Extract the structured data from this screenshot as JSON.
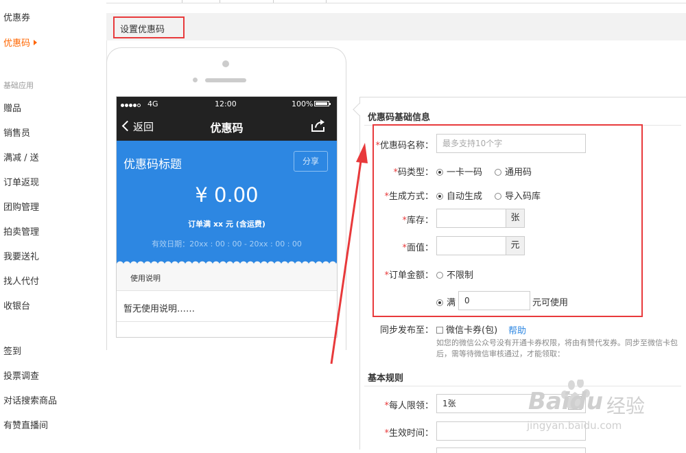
{
  "sidebar": {
    "items_top": [
      {
        "label": "优惠券",
        "active": false
      },
      {
        "label": "优惠码",
        "active": true
      }
    ],
    "category": "基础应用",
    "items_basic": [
      "赠品",
      "销售员",
      "满减 / 送",
      "订单返现",
      "团购管理",
      "拍卖管理",
      "我要送礼",
      "找人代付",
      "收银台"
    ],
    "items_bottom": [
      "签到",
      "投票调查",
      "对话搜索商品",
      "有赞直播间"
    ]
  },
  "page": {
    "title": "设置优惠码"
  },
  "phone": {
    "status": {
      "signal": "4G",
      "time": "12:00",
      "battery": "100%"
    },
    "nav": {
      "back": "返回",
      "title": "优惠码"
    },
    "coupon": {
      "title": "优惠码标题",
      "share": "分享",
      "amount": "¥ 0.00",
      "condition": "订单满 xx 元 (含运费)",
      "validity": "有效日期：20xx : 00 : 00 - 20xx : 00 : 00"
    },
    "usage": {
      "label": "使用说明",
      "text": "暂无使用说明……"
    }
  },
  "form": {
    "basic_title": "优惠码基础信息",
    "name": {
      "label": "优惠码名称：",
      "placeholder": "最多支持10个字"
    },
    "code_type": {
      "label": "码类型：",
      "options": [
        "一卡一码",
        "通用码"
      ],
      "selected": 0
    },
    "gen_method": {
      "label": "生成方式：",
      "options": [
        "自动生成",
        "导入码库"
      ],
      "selected": 0
    },
    "stock": {
      "label": "库存：",
      "unit": "张"
    },
    "face_value": {
      "label": "面值：",
      "unit": "元"
    },
    "order_amount": {
      "label": "订单金额：",
      "option_unlimited": "不限制",
      "option_min": "满",
      "min_value": "0",
      "suffix": "元可使用"
    },
    "sync": {
      "label": "同步发布至：",
      "checkbox": "微信卡券(包)",
      "help": "帮助",
      "note": "如您的微信公众号没有开通卡券权限，将由有赞代发券。同步至微信卡包后，需等待微信审核通过，才能领取："
    },
    "rules_title": "基本规则",
    "per_limit": {
      "label": "每人限领：",
      "value": "1张"
    },
    "effective_time": {
      "label": "生效时间："
    }
  },
  "watermark": {
    "brand": "Baidu",
    "cn": "经验",
    "url": "jingyan.baidu.com"
  },
  "colors": {
    "accent": "#ff6600",
    "highlight_red": "#e8393b",
    "coupon_blue": "#2d87e2",
    "link_blue": "#2d87e2"
  }
}
